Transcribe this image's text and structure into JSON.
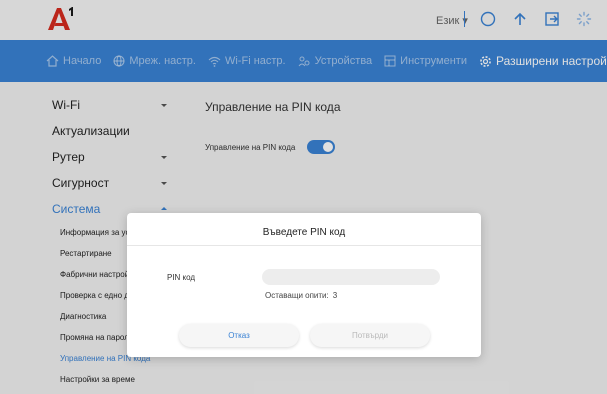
{
  "header": {
    "language_label": "Език",
    "language_caret": "▾"
  },
  "nav": {
    "items": [
      {
        "label": "Начало",
        "icon": "home-icon"
      },
      {
        "label": "Мреж. настр.",
        "icon": "globe-icon"
      },
      {
        "label": "Wi-Fi настр.",
        "icon": "wifi-icon"
      },
      {
        "label": "Устройства",
        "icon": "devices-icon"
      },
      {
        "label": "Инструменти",
        "icon": "tools-icon"
      },
      {
        "label": "Разширени настройки",
        "icon": "gear-icon"
      }
    ]
  },
  "sidebar": {
    "items": [
      {
        "label": "Wi-Fi",
        "has_chevron": true
      },
      {
        "label": "Актуализации",
        "has_chevron": false
      },
      {
        "label": "Рутер",
        "has_chevron": true
      },
      {
        "label": "Сигурност",
        "has_chevron": true
      },
      {
        "label": "Система",
        "has_chevron": true
      }
    ],
    "sub_items": [
      "Информация за устройството",
      "Рестартиране",
      "Фабрични настройки",
      "Проверка с едно докосване",
      "Диагностика",
      "Промяна на паролата",
      "Управление на PIN кода",
      "Настройки за време"
    ]
  },
  "main": {
    "title": "Управление на PIN кода",
    "pin_toggle_label": "Управление на PIN кода",
    "pin_toggle_on": true
  },
  "modal": {
    "title": "Въведете PIN код",
    "pin_label": "PIN код",
    "pin_value": "",
    "pin_placeholder": "",
    "attempts_label": "Оставащи опити:",
    "attempts_count": "3",
    "cancel_label": "Отказ",
    "confirm_label": "Потвърди"
  },
  "colors": {
    "accent": "#3a82d4",
    "logo_red": "#d52b1e"
  }
}
